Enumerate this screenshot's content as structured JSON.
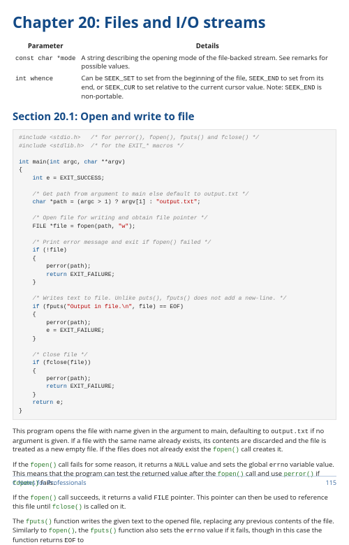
{
  "chapter_title": "Chapter 20: Files and I/O streams",
  "table": {
    "headers": {
      "param": "Parameter",
      "details": "Details"
    },
    "rows": [
      {
        "param": "const char *mode",
        "details": "A string describing the opening mode of the file-backed stream. See remarks for possible values."
      },
      {
        "param": "int whence",
        "details_prefix": "Can be ",
        "c1": "SEEK_SET",
        "d1": " to set from the beginning of the file, ",
        "c2": "SEEK_END",
        "d2": " to set from its end, or ",
        "c3": "SEEK_CUR",
        "d3": " to set relative to the current cursor value. Note: ",
        "c4": "SEEK_END",
        "d4": " is non-portable."
      }
    ]
  },
  "section_title": "Section 20.1: Open and write to file",
  "para1": {
    "t1": "This program opens the file with name given in the argument to main, defaulting to ",
    "c1": "output.txt",
    "t2": " if no argument is given. If a file with the same name already exists, its contents are discarded and the file is treated as a new empty file. If the files does not already exist the ",
    "c2": "fopen()",
    "t3": " call creates it."
  },
  "para2": {
    "t1": "If the ",
    "c1": "fopen()",
    "t2": " call fails for some reason, it returns a ",
    "c2": "NULL",
    "t3": " value and sets the global ",
    "c3": "errno",
    "t4": " variable value. This means that the program can test the returned value after the ",
    "c4": "fopen()",
    "t5": " call and use ",
    "c5": "perror()",
    "t6": " if ",
    "c6": "fopen()",
    "t7": " fails."
  },
  "para3": {
    "t1": "If the ",
    "c1": "fopen()",
    "t2": " call succeeds, it returns a valid ",
    "c2": "FILE",
    "t3": " pointer. This pointer can then be used to reference this file until ",
    "c3": "fclose()",
    "t4": " is called on it."
  },
  "para4": {
    "t1": "The ",
    "c1": "fputs()",
    "t2": " function writes the given text to the opened file, replacing any previous contents of the file. Similarly to ",
    "c2": "fopen()",
    "t3": ", the ",
    "c3": "fputs()",
    "t4": " function also sets the ",
    "c4": "errno",
    "t5": " value if it fails, though in this case the function returns ",
    "c5": "EOF",
    "t6": " to"
  },
  "footer": {
    "left": "C Notes for Professionals",
    "right": "115"
  }
}
